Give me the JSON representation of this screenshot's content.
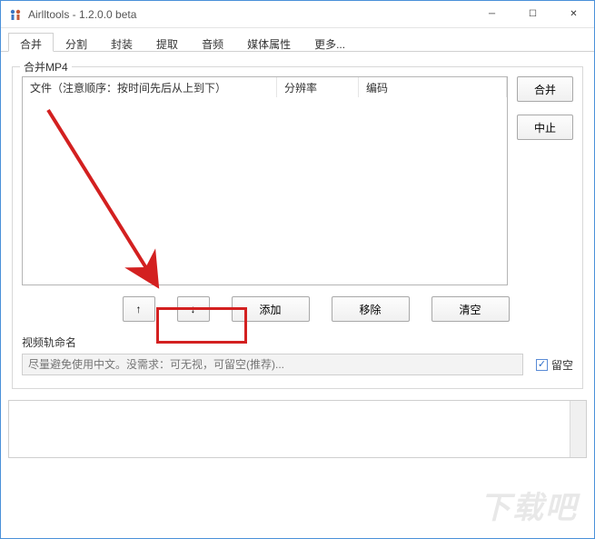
{
  "window": {
    "title": "Airlltools  -  1.2.0.0 beta"
  },
  "tabs": {
    "items": [
      {
        "label": "合并",
        "active": true
      },
      {
        "label": "分割",
        "active": false
      },
      {
        "label": "封装",
        "active": false
      },
      {
        "label": "提取",
        "active": false
      },
      {
        "label": "音频",
        "active": false
      },
      {
        "label": "媒体属性",
        "active": false
      },
      {
        "label": "更多...",
        "active": false
      }
    ]
  },
  "group": {
    "title": "合并MP4"
  },
  "table": {
    "headers": {
      "file": "文件（注意顺序：按时间先后从上到下）",
      "resolution": "分辨率",
      "codec": "编码"
    }
  },
  "side_buttons": {
    "merge": "合并",
    "stop": "中止"
  },
  "bottom_buttons": {
    "up": "↑",
    "down": "↓",
    "add": "添加",
    "remove": "移除",
    "clear": "清空"
  },
  "rename": {
    "label": "视频轨命名",
    "placeholder": "尽量避免使用中文。没需求：可无视，可留空(推荐)...",
    "checkbox_label": "留空",
    "checkbox_checked": true
  },
  "watermark": "下载吧",
  "annotation": {
    "highlight_target": "add-button"
  }
}
